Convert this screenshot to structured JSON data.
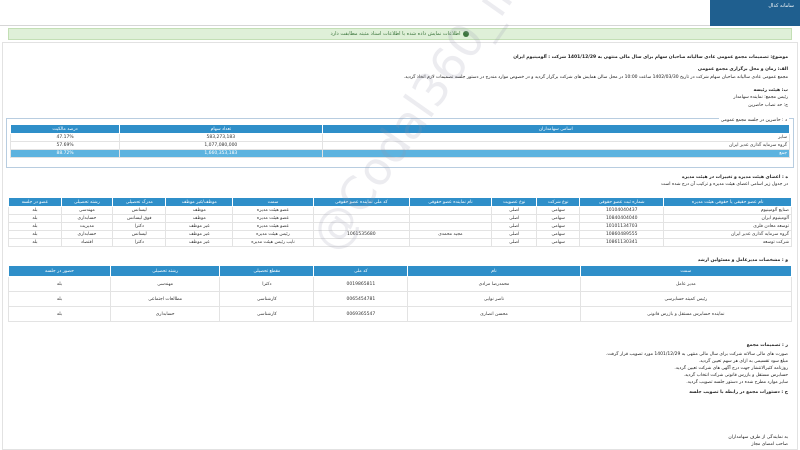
{
  "topbar": {
    "title": "سامانه کدال"
  },
  "notice": {
    "text": "اطلاعات نمایش داده شده با اطلاعات اسناد مثبته مطابقت دارد"
  },
  "header": {
    "subject": "موضوع: تصمیمات مجمع عمومی عادی سالیانه صاحبان سهام برای سال مالی منتهی به 1401/12/29 شرکت : آلومینیوم ایران",
    "section_a": "الف: زمان و محل برگزاری مجمع عمومی",
    "meeting_desc": "مجمع عمومی عادی سالیانه صاحبان سهام شرکت در تاریخ 1402/03/30 ساعت 10:00 در محل سالن همایش های شرکت برگزار گردید و در خصوص موارد مندرج در دستور جلسه تصمیمات لازم اتخاذ گردید.",
    "presidium": "ب: هیئت رئیسه",
    "chairman": "رئیس مجمع: نماینده سهامدار",
    "quorum": "ج: حد نصاب حاضرین"
  },
  "shareholders": {
    "title": "د : حاضرین در جلسه مجمع عمومی",
    "headers": [
      "اسامی سهامداران",
      "تعداد سهام",
      "درصد مالکیت"
    ],
    "rows": [
      [
        "سایر",
        "583,273,183",
        "47.17%"
      ],
      [
        "گروه سرمایه گذاری غدیر ایران",
        "1,077,080,000",
        "57.69%"
      ],
      [
        "جمع",
        "1,660,353,183",
        "88.72%"
      ]
    ]
  },
  "board": {
    "title": "ه : اعضای هیئت مدیره و تغییرات در هیئت مدیره",
    "subtitle": "در جدول زیر اسامی اعضای هیئت مدیره و ترکیب آن درج شده است",
    "headers": [
      "نام عضو حقیقی یا حقوقی هیئت مدیره",
      "شماره ثبت عضو حقوقی",
      "نوع شرکت",
      "نوع عضویت",
      "نام نماینده عضو حقوقی",
      "کد ملی نماینده عضو حقوقی",
      "سمت",
      "موظف/غیر موظف",
      "مدرک تحصیلی",
      "رشته تحصیلی",
      "عضو در جلسه"
    ],
    "rows": [
      [
        "صنایع آلومینیوم",
        "10104040437",
        "سهامی",
        "اصلی",
        "",
        "",
        "عضو هیئت مدیره",
        "موظف",
        "لیسانس",
        "مهندسی",
        "بله"
      ],
      [
        "آلومینیوم ایران",
        "10840404040",
        "سهامی",
        "اصلی",
        "",
        "",
        "عضو هیئت مدیره",
        "موظف",
        "فوق لیسانس",
        "حسابداری",
        "بله"
      ],
      [
        "توسعه معادن فلزی",
        "10101134703",
        "سهامی",
        "اصلی",
        "",
        "",
        "عضو هیئت مدیره",
        "غیر موظف",
        "دکترا",
        "مدیریت",
        "بله"
      ],
      [
        "گروه سرمایه گذاری غدیر ایران",
        "10860489555",
        "سهامی",
        "اصلی",
        "مجید محمدی",
        "1061535680",
        "رئیس هیئت مدیره",
        "غیر موظف",
        "لیسانس",
        "حسابداری",
        "بله"
      ],
      [
        "شرکت توسعه",
        "10861130341",
        "سهامی",
        "اصلی",
        "",
        "",
        "نایب رئیس هیئت مدیره",
        "غیر موظف",
        "دکترا",
        "اقتصاد",
        "بله"
      ]
    ]
  },
  "managers": {
    "title": "و : مشخصات مدیرعامل و مسئولین ارشد",
    "headers": [
      "سمت",
      "نام",
      "کد ملی",
      "مقطع تحصیلی",
      "رشته تحصیلی",
      "حضور در جلسه"
    ],
    "rows": [
      [
        "مدیر عامل",
        "محمدرضا مرادی",
        "0019865811",
        "دکترا",
        "مهندسی",
        "بله"
      ],
      [
        "رئیس کمیته حسابرسی",
        "ناصر نوایی",
        "0065454781",
        "کارشناسی",
        "مطالعات اجتماعی",
        "بله"
      ],
      [
        "نماینده حسابرس مستقل و بازرس قانونی",
        "محسن انصاری",
        "0069365547",
        "کارشناسی",
        "حسابداری",
        "بله"
      ]
    ]
  },
  "decisions": {
    "title": "ز : تصمیمات مجمع",
    "lines": [
      "صورت های مالی سالانه شرکت برای سال مالی منتهی به 1401/12/29 مورد تصویب قرار گرفت.",
      "مبلغ سود تقسیمی به ازای هر سهم تعیین گردید.",
      "روزنامه کثیرالانتشار جهت درج آگهی های شرکت تعیین گردید.",
      "حسابرس مستقل و بازرس قانونی شرکت انتخاب گردید.",
      "سایر موارد مطرح شده در دستور جلسه تصویب گردید."
    ],
    "extra": "ح : دستورات مجمع در رابطه با تصویب جلسه",
    "footer1": "به نمایندگی از طرف سهامداران",
    "footer2": "صاحب امضای مجاز"
  },
  "watermark": "@Codal360_ir"
}
